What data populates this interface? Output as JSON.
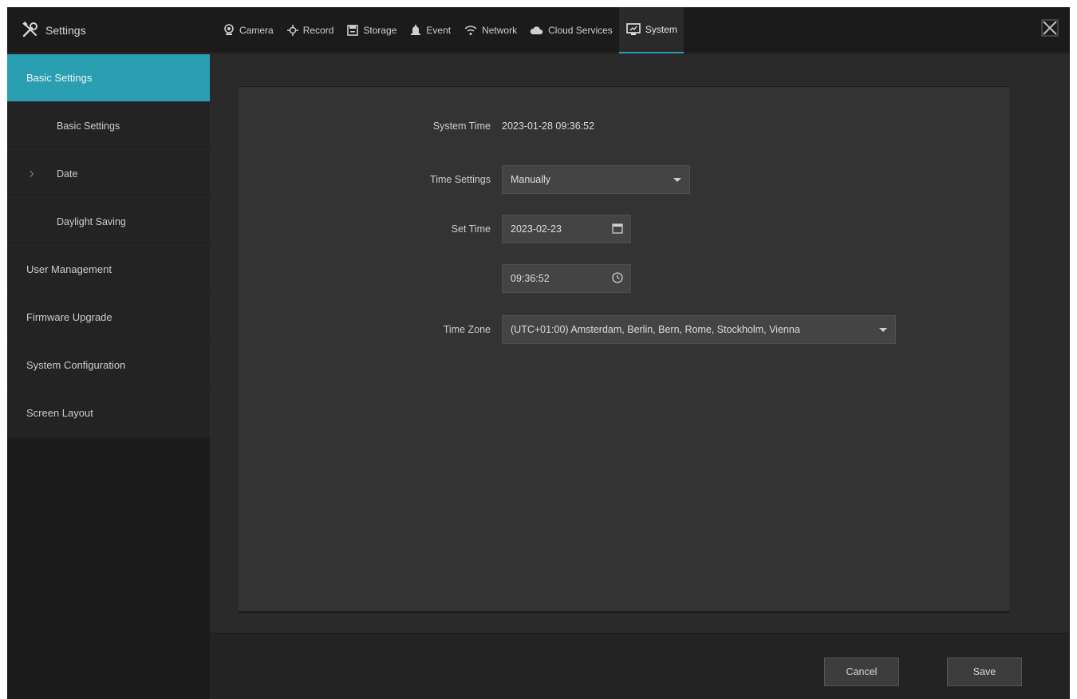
{
  "app": {
    "title": "Settings",
    "title_icon": "tools-icon",
    "close_icon": "close-icon"
  },
  "tabs": [
    {
      "label": "Camera",
      "icon": "camera-icon"
    },
    {
      "label": "Record",
      "icon": "record-icon"
    },
    {
      "label": "Storage",
      "icon": "storage-icon"
    },
    {
      "label": "Event",
      "icon": "event-icon"
    },
    {
      "label": "Network",
      "icon": "network-icon"
    },
    {
      "label": "Cloud Services",
      "icon": "cloud-icon"
    },
    {
      "label": "System",
      "icon": "system-monitor-icon",
      "active": true
    }
  ],
  "sidebar": {
    "items": [
      {
        "label": "Basic Settings",
        "active": true
      },
      {
        "label": "Basic Settings",
        "sub": true
      },
      {
        "label": "Date",
        "sub": true
      },
      {
        "label": "Daylight Saving",
        "sub": true
      },
      {
        "label": "User Management"
      },
      {
        "label": "Firmware Upgrade"
      },
      {
        "label": "System Configuration"
      },
      {
        "label": "Screen Layout"
      }
    ]
  },
  "form": {
    "system_time_label": "System Time",
    "system_time_value": "2023-01-28 09:36:52",
    "time_settings_label": "Time Settings",
    "time_settings_value": "Manually",
    "set_time_label": "Set Time",
    "set_date_value": "2023-02-23",
    "set_clock_value": "09:36:52",
    "time_zone_label": "Time Zone",
    "time_zone_value": "(UTC+01:00) Amsterdam, Berlin, Bern, Rome, Stockholm, Vienna"
  },
  "footer": {
    "cancel_label": "Cancel",
    "save_label": "Save"
  },
  "colors": {
    "accent": "#2a9fb2",
    "background": "#202020",
    "panel": "#333333"
  }
}
